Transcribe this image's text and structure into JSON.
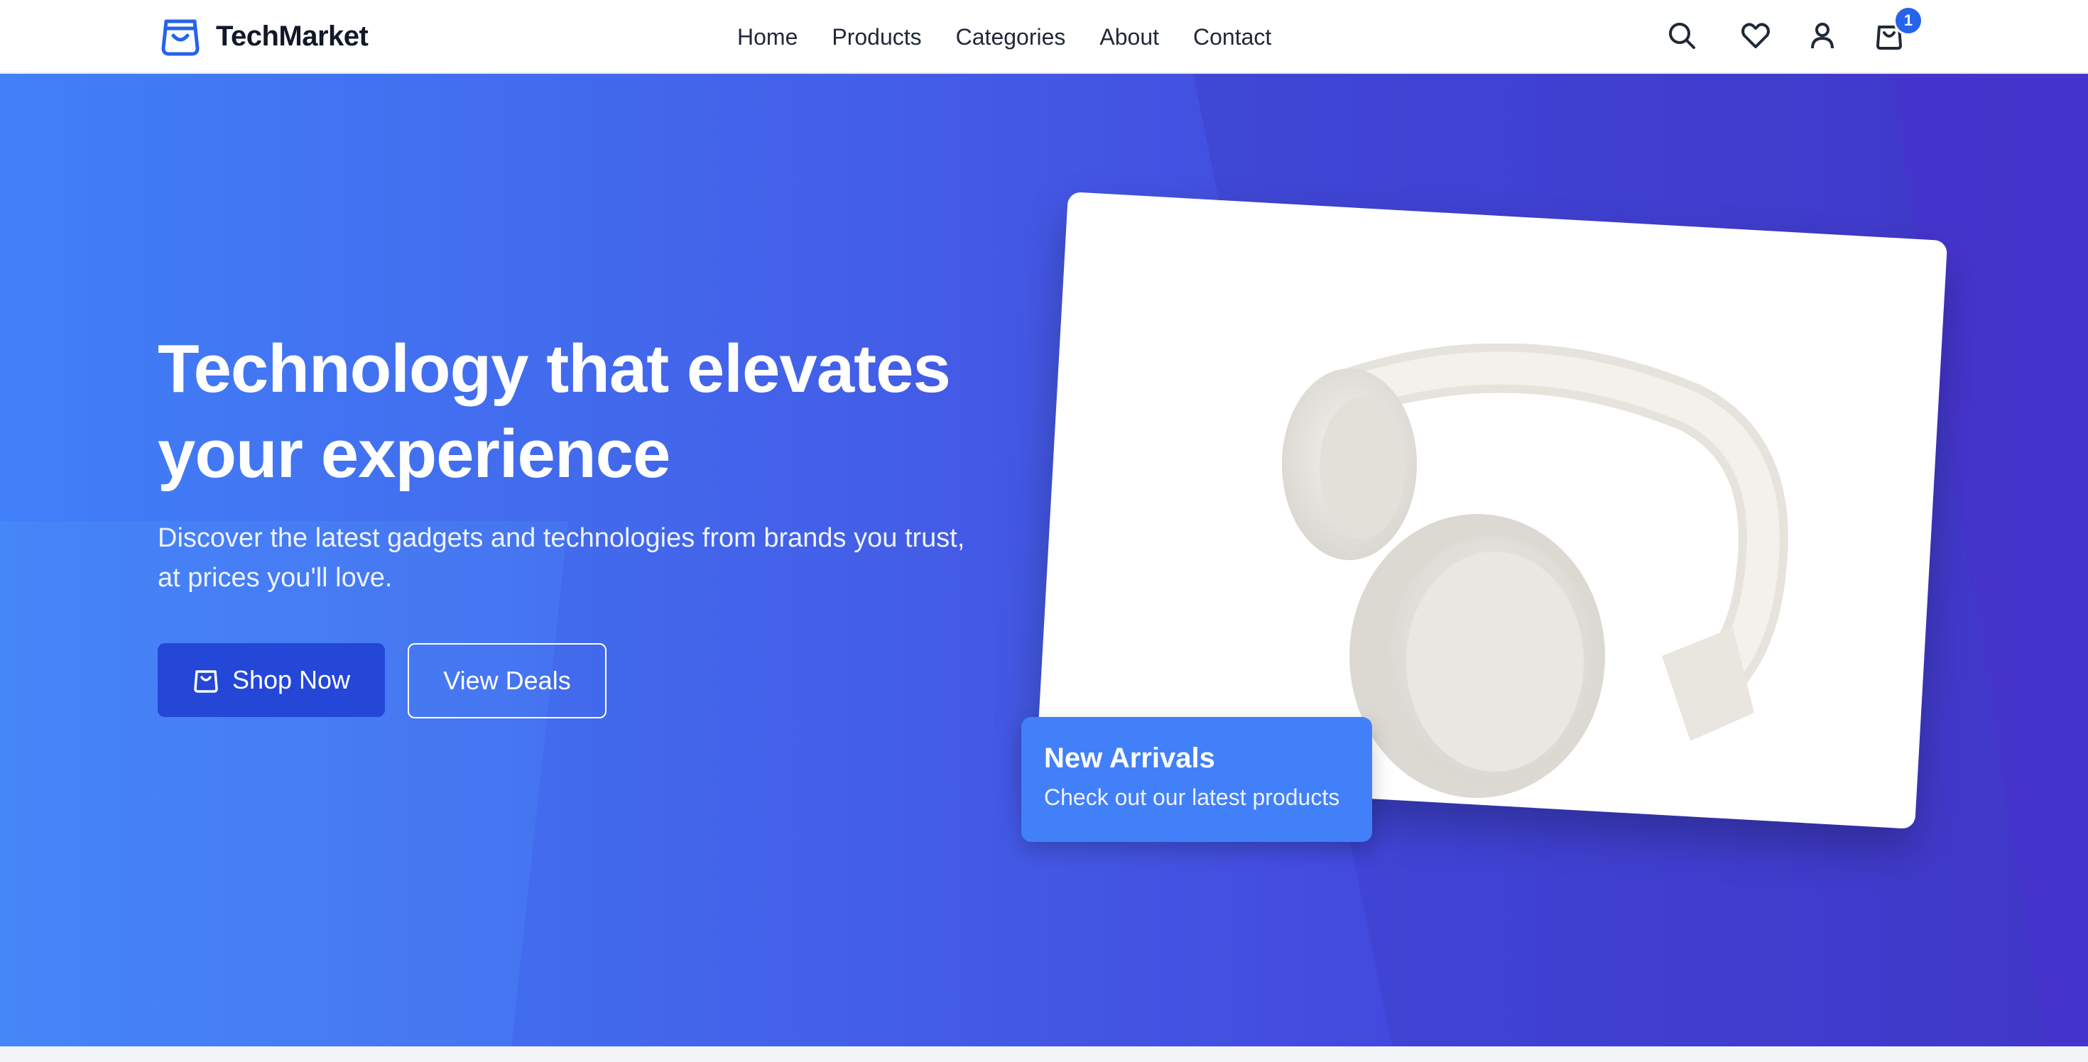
{
  "brand": {
    "name": "TechMarket",
    "accent": "#2563eb",
    "icon": "shopping-bag-icon"
  },
  "nav": {
    "links": [
      "Home",
      "Products",
      "Categories",
      "About",
      "Contact"
    ],
    "icons": [
      "search-icon",
      "heart-icon",
      "user-icon",
      "cart-icon"
    ],
    "cart_count": "1"
  },
  "hero": {
    "title": "Technology that elevates your experience",
    "subtitle": "Discover the latest gadgets and technologies from brands you trust, at prices you'll love.",
    "primary_button": "Shop Now",
    "secondary_button": "View Deals",
    "gradient": [
      "#4180f8",
      "#4532c8"
    ]
  },
  "promo": {
    "title": "New Arrivals",
    "subtitle": "Check out our latest products",
    "color": "#4180f8"
  }
}
